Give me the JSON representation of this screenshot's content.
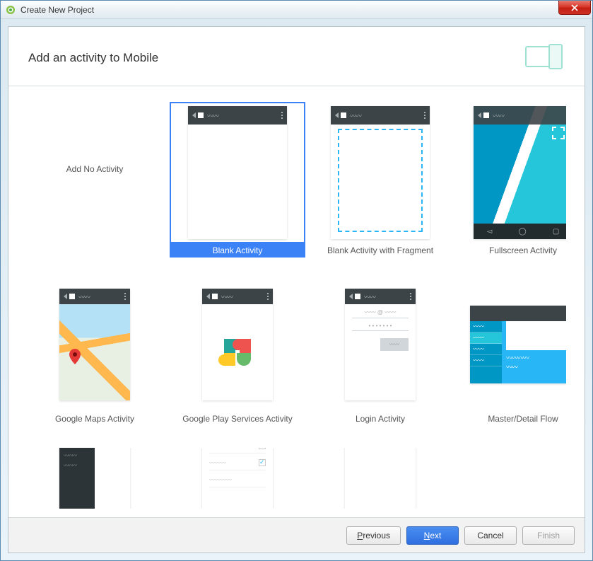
{
  "window": {
    "title": "Create New Project"
  },
  "header": {
    "title": "Add an activity to Mobile"
  },
  "activities": [
    {
      "id": "none",
      "label": "Add No Activity",
      "selected": false,
      "noThumb": true
    },
    {
      "id": "blank",
      "label": "Blank Activity",
      "selected": true,
      "big": true
    },
    {
      "id": "fragment",
      "label": "Blank Activity with Fragment",
      "selected": false,
      "big": true
    },
    {
      "id": "fullscreen",
      "label": "Fullscreen Activity",
      "selected": false,
      "big": true
    },
    {
      "id": "maps",
      "label": "Google Maps Activity",
      "selected": false
    },
    {
      "id": "play",
      "label": "Google Play Services Activity",
      "selected": false
    },
    {
      "id": "login",
      "label": "Login Activity",
      "selected": false
    },
    {
      "id": "masterdetail",
      "label": "Master/Detail Flow",
      "selected": false
    },
    {
      "id": "navdrawer",
      "label": "",
      "selected": false
    },
    {
      "id": "settings",
      "label": "",
      "selected": false
    },
    {
      "id": "tabbed",
      "label": "",
      "selected": false
    }
  ],
  "buttons": {
    "previous": "Previous",
    "next": "Next",
    "cancel": "Cancel",
    "finish": "Finish"
  },
  "colors": {
    "selection": "#3b82f6",
    "accent": "#29b6f6",
    "toolbar": "#3d4447"
  }
}
